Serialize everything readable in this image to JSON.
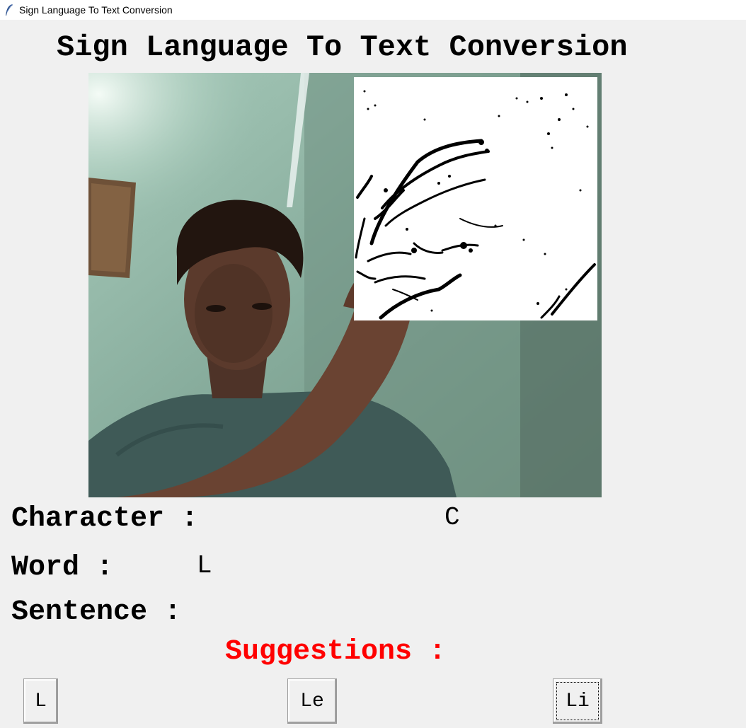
{
  "window": {
    "title": "Sign Language To Text Conversion"
  },
  "heading": "Sign Language To Text Conversion",
  "fields": {
    "character_label": "Character :",
    "character_value": "C",
    "word_label": "Word :",
    "word_value": "L",
    "sentence_label": "Sentence :",
    "sentence_value": ""
  },
  "suggestions": {
    "label": "Suggestions :",
    "items": [
      "L",
      "Le",
      "Li"
    ]
  },
  "colors": {
    "background": "#f0f0f0",
    "suggestions_label": "#ff0000"
  }
}
